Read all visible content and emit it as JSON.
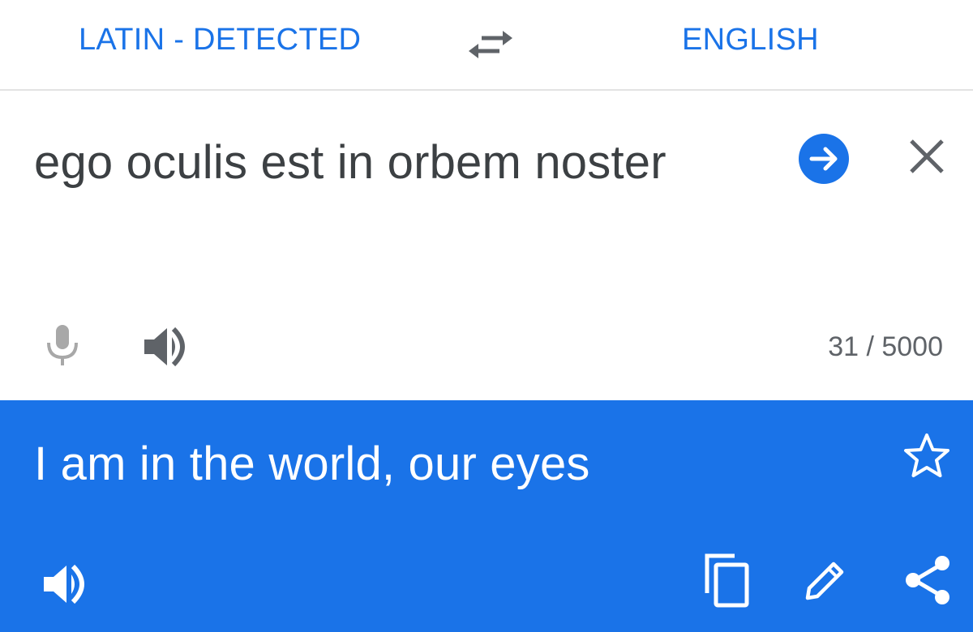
{
  "colors": {
    "accent": "#1a73e8",
    "icon_gray": "#5f6368",
    "mic_gray": "#a8a8a8",
    "source_text": "#3c4043",
    "count_text": "#5f6368",
    "output_text": "#ffffff"
  },
  "language_bar": {
    "source_language": "LATIN - DETECTED",
    "target_language": "ENGLISH",
    "swap_icon": "swap-arrows-icon"
  },
  "input": {
    "source_text": "ego oculis est in orbem noster",
    "go_icon": "arrow-right-circle-icon",
    "clear_icon": "close-icon",
    "mic_icon": "microphone-icon",
    "speaker_icon": "speaker-icon",
    "char_count": "31 / 5000"
  },
  "output": {
    "translated_text": "I am in the world, our eyes",
    "star_icon": "star-outline-icon",
    "speaker_icon": "speaker-icon",
    "copy_icon": "copy-icon",
    "edit_icon": "pencil-icon",
    "share_icon": "share-icon"
  }
}
